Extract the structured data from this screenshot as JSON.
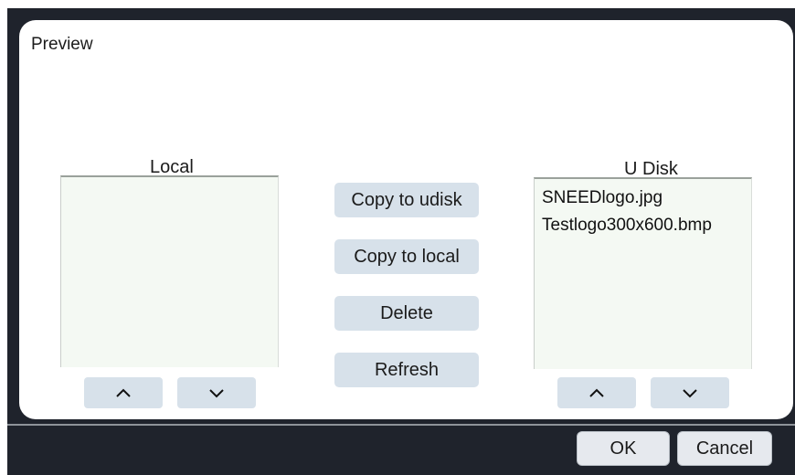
{
  "dialog": {
    "preview_label": "Preview"
  },
  "local": {
    "title": "Local",
    "files": []
  },
  "udisk": {
    "title": "U Disk",
    "files": [
      "SNEEDlogo.jpg",
      "Testlogo300x600.bmp"
    ]
  },
  "actions": {
    "copy_to_udisk": "Copy to udisk",
    "copy_to_local": "Copy to local",
    "delete": "Delete",
    "refresh": "Refresh"
  },
  "footer": {
    "ok": "OK",
    "cancel": "Cancel"
  },
  "icons": {
    "up": "chevron-up-icon",
    "down": "chevron-down-icon"
  },
  "colors": {
    "window_background": "#1f232c",
    "panel_background": "#ffffff",
    "button_background": "#d7e1ea",
    "listbox_background": "#f4f9f3"
  }
}
